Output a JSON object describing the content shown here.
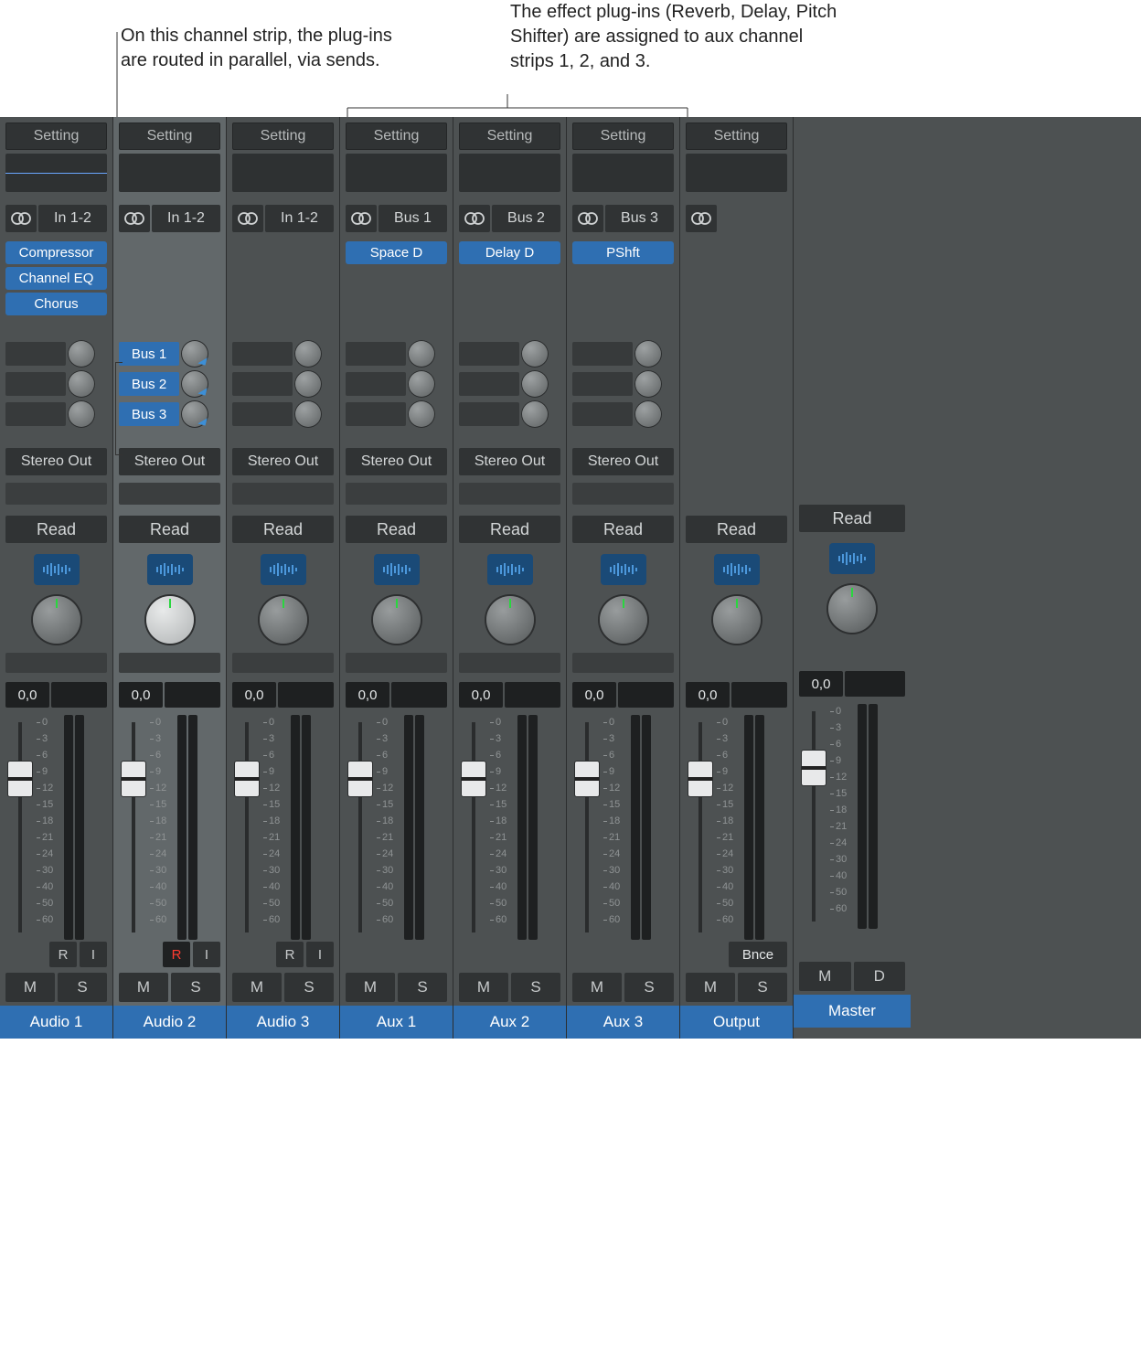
{
  "annotations": {
    "left": "On this channel strip, the plug-ins are routed in parallel, via sends.",
    "right": "The effect plug-ins (Reverb, Delay, Pitch Shifter) are assigned to aux channel strips 1, 2, and 3."
  },
  "colors": {
    "accent": "#2f6fb2",
    "bg": "#4d5152"
  },
  "fader_scale": [
    "0",
    "3",
    "6",
    "9",
    "12",
    "15",
    "18",
    "21",
    "24",
    "30",
    "40",
    "50",
    "60"
  ],
  "common": {
    "setting": "Setting",
    "stereo_out": "Stereo Out",
    "read": "Read",
    "mute": "M",
    "solo": "S",
    "dim": "D",
    "rec": "R",
    "input_mon": "I",
    "bnce": "Bnce"
  },
  "strips": [
    {
      "name": "Audio 1",
      "input": "In 1-2",
      "eq_thumb": true,
      "plugins": [
        "Compressor",
        "Channel EQ",
        "Chorus"
      ],
      "sends": [
        {
          "label": null
        },
        {
          "label": null
        },
        {
          "label": null
        }
      ],
      "output": "Stereo Out",
      "db": "0,0",
      "ri": true,
      "ms": [
        "M",
        "S"
      ]
    },
    {
      "name": "Audio 2",
      "selected": true,
      "input": "In 1-2",
      "eq_thumb": false,
      "plugins": [],
      "sends": [
        {
          "label": "Bus 1",
          "active": true
        },
        {
          "label": "Bus 2",
          "active": true
        },
        {
          "label": "Bus 3",
          "active": true
        }
      ],
      "output": "Stereo Out",
      "db": "0,0",
      "ri": true,
      "rec_armed": true,
      "ms": [
        "M",
        "S"
      ]
    },
    {
      "name": "Audio 3",
      "input": "In 1-2",
      "eq_thumb": false,
      "plugins": [],
      "sends": [
        {
          "label": null
        },
        {
          "label": null
        },
        {
          "label": null
        }
      ],
      "output": "Stereo Out",
      "db": "0,0",
      "ri": true,
      "ms": [
        "M",
        "S"
      ]
    },
    {
      "name": "Aux 1",
      "input": "Bus 1",
      "eq_thumb": false,
      "plugins": [
        "Space D"
      ],
      "sends": [
        {
          "label": null
        },
        {
          "label": null
        },
        {
          "label": null
        }
      ],
      "output": "Stereo Out",
      "db": "0,0",
      "ri": false,
      "ms": [
        "M",
        "S"
      ]
    },
    {
      "name": "Aux 2",
      "input": "Bus 2",
      "eq_thumb": false,
      "plugins": [
        "Delay D"
      ],
      "sends": [
        {
          "label": null
        },
        {
          "label": null
        },
        {
          "label": null
        }
      ],
      "output": "Stereo Out",
      "db": "0,0",
      "ri": false,
      "ms": [
        "M",
        "S"
      ]
    },
    {
      "name": "Aux 3",
      "input": "Bus 3",
      "eq_thumb": false,
      "plugins": [
        "PShft"
      ],
      "sends": [
        {
          "label": null
        },
        {
          "label": null
        },
        {
          "label": null
        }
      ],
      "output": "Stereo Out",
      "db": "0,0",
      "ri": false,
      "ms": [
        "M",
        "S"
      ]
    },
    {
      "name": "Output",
      "input": null,
      "stereo_only": true,
      "plugins": [],
      "no_sends_area": true,
      "output": null,
      "no_group": true,
      "db": "0,0",
      "bnce": true,
      "ms": [
        "M",
        "S"
      ]
    },
    {
      "name": "Master",
      "minimal": true,
      "db": "0,0",
      "ms": [
        "M",
        "D"
      ]
    }
  ]
}
